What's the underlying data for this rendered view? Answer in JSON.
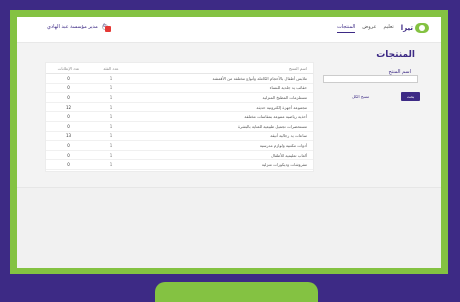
{
  "app": {
    "logo_text": "تيرا",
    "nav": [
      {
        "label": "تعليم",
        "active": false
      },
      {
        "label": "عروض",
        "active": false
      },
      {
        "label": "المنتجات",
        "active": true
      }
    ],
    "user": {
      "name": "مدير مؤسسة عبد الهادي"
    },
    "notifications": {
      "count": "0"
    }
  },
  "page": {
    "title": "المنتجات",
    "search": {
      "label": "اسم المنتج",
      "value": "",
      "placeholder": "",
      "button_label": "بحث",
      "clear_label": "مسح الكل"
    },
    "table": {
      "headers": {
        "name": "اسم المنتج",
        "category": "عدد الفئة",
        "count": "عدد الإعلانات"
      },
      "rows": [
        {
          "name": "ملابس أطفال بالأحجام الكاملة وأنواع مختلفة من الأقمشة",
          "category": "1",
          "count": "0"
        },
        {
          "name": "حقائب يد جلدية للنساء",
          "category": "1",
          "count": "0"
        },
        {
          "name": "مستلزمات المطبخ المنزلية",
          "category": "1",
          "count": "0"
        },
        {
          "name": "مجموعة أجهزة إلكترونية حديثة",
          "category": "1",
          "count": "12"
        },
        {
          "name": "أحذية رياضية متنوعة بمقاسات مختلفة",
          "category": "1",
          "count": "0"
        },
        {
          "name": "مستحضرات تجميل طبيعية للعناية بالبشرة",
          "category": "1",
          "count": "0"
        },
        {
          "name": "ساعات يد رجالية أنيقة",
          "category": "1",
          "count": "13"
        },
        {
          "name": "أدوات مكتبية ولوازم مدرسية",
          "category": "1",
          "count": "0"
        },
        {
          "name": "ألعاب تعليمية للأطفال",
          "category": "1",
          "count": "0"
        },
        {
          "name": "مفروشات وديكورات منزلية",
          "category": "1",
          "count": "0"
        }
      ]
    }
  },
  "colors": {
    "frame": "#84c242",
    "border": "#3d2a85",
    "accent": "#3d2a85",
    "alert": "#e53935"
  }
}
